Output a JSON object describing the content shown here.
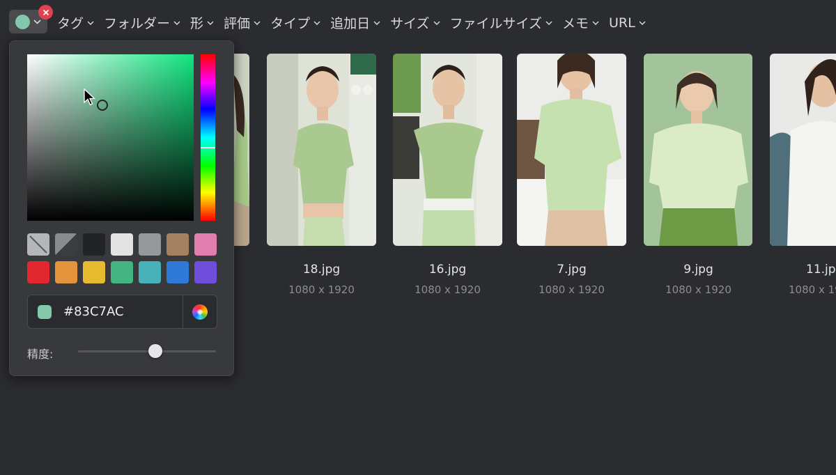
{
  "filter_bar": {
    "selected_color": "#83C7AC",
    "filters": [
      "タグ",
      "フォルダー",
      "形",
      "評価",
      "タイプ",
      "追加日",
      "サイズ",
      "ファイルサイズ",
      "メモ",
      "URL"
    ]
  },
  "files": [
    {
      "name": "",
      "size": ""
    },
    {
      "name": "18.jpg",
      "size": "1080 x 1920"
    },
    {
      "name": "16.jpg",
      "size": "1080 x 1920"
    },
    {
      "name": "7.jpg",
      "size": "1080 x 1920"
    },
    {
      "name": "9.jpg",
      "size": "1080 x 1920"
    },
    {
      "name": "11.jpg",
      "size": "1080 x 1920"
    }
  ],
  "color_picker": {
    "hex_value": "#83C7AC",
    "precision_label": "精度:",
    "precision_level": 0.56,
    "swatches": [
      {
        "name": "none",
        "color": "#b5b6b8"
      },
      {
        "name": "transparent",
        "color": "#6c6d70"
      },
      {
        "name": "black",
        "color": "#222325"
      },
      {
        "name": "white",
        "color": "#e3e3e4"
      },
      {
        "name": "gray",
        "color": "#97989a"
      },
      {
        "name": "brown",
        "color": "#a5825f"
      },
      {
        "name": "pink",
        "color": "#e07fad"
      },
      {
        "name": "red",
        "color": "#e0282e"
      },
      {
        "name": "orange",
        "color": "#e5923d"
      },
      {
        "name": "yellow",
        "color": "#e7bb2f"
      },
      {
        "name": "green",
        "color": "#44b482"
      },
      {
        "name": "teal",
        "color": "#48b0b8"
      },
      {
        "name": "blue",
        "color": "#2f79d9"
      },
      {
        "name": "purple",
        "color": "#6f4ddb"
      }
    ]
  }
}
